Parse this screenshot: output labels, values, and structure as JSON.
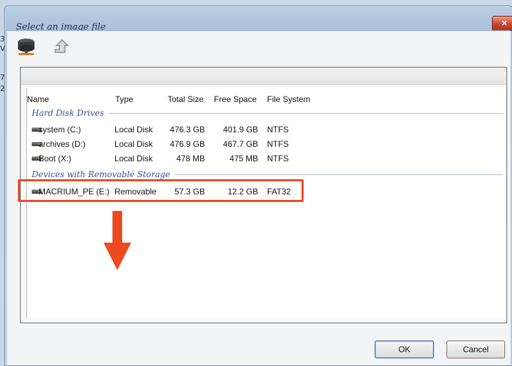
{
  "window": {
    "title": "Select an image file",
    "close_label": "×"
  },
  "edge_glyphs": [
    "3",
    "V",
    "7",
    "2"
  ],
  "columns": {
    "name": "Name",
    "type": "Type",
    "total": "Total Size",
    "free": "Free Space",
    "fs": "File System"
  },
  "groups": {
    "hdd": "Hard Disk Drives",
    "removable": "Devices with Removable Storage"
  },
  "hdd_rows": [
    {
      "name": "system (C:)",
      "type": "Local Disk",
      "total": "476.3 GB",
      "free": "401.9 GB",
      "fs": "NTFS"
    },
    {
      "name": "archives (D:)",
      "type": "Local Disk",
      "total": "476.9 GB",
      "free": "467.7 GB",
      "fs": "NTFS"
    },
    {
      "name": "Boot (X:)",
      "type": "Local Disk",
      "total": "478 MB",
      "free": "475 MB",
      "fs": "NTFS"
    }
  ],
  "removable_rows": [
    {
      "name": "MACRIUM_PE (E:)",
      "type": "Removable",
      "total": "57.3 GB",
      "free": "12.2 GB",
      "fs": "FAT32"
    }
  ],
  "buttons": {
    "ok": "OK",
    "cancel": "Cancel"
  },
  "colors": {
    "annotation": "#ee4a22",
    "group_text": "#2c4f96"
  },
  "icons": {
    "toolbar_1": "network-drive-icon",
    "toolbar_2": "up-folder-icon",
    "drive": "drive-icon"
  }
}
